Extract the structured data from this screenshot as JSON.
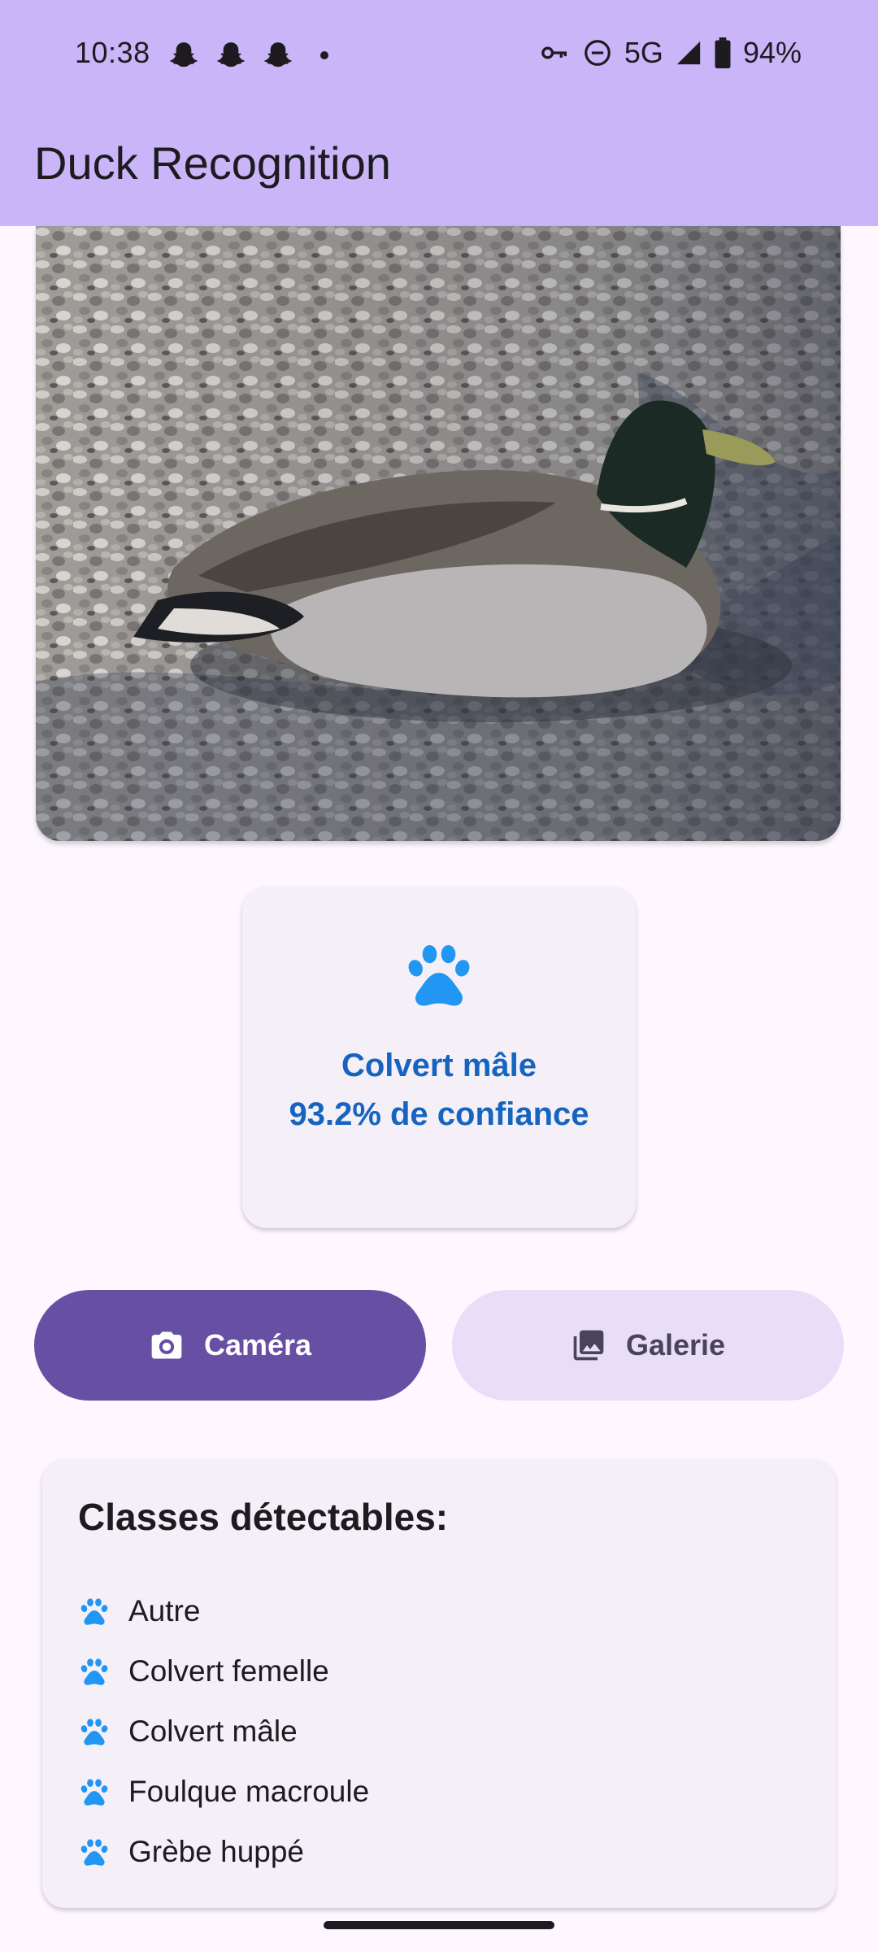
{
  "status_bar": {
    "time": "10:38",
    "notification_icons": [
      "snapchat-icon",
      "snapchat-icon",
      "snapchat-icon",
      "more-dot-icon"
    ],
    "right_icons": [
      "vpn-key-icon",
      "do-not-disturb-icon",
      "signal-icon",
      "battery-icon"
    ],
    "network": "5G",
    "battery": "94%"
  },
  "app_bar": {
    "title": "Duck Recognition"
  },
  "result": {
    "icon": "paw-icon",
    "label": "Colvert mâle",
    "confidence": "93.2% de confiance"
  },
  "buttons": {
    "camera": {
      "label": "Caméra",
      "icon": "camera-icon"
    },
    "gallery": {
      "label": "Galerie",
      "icon": "gallery-icon"
    }
  },
  "classes": {
    "title": "Classes détectables:",
    "items": [
      {
        "label": "Autre"
      },
      {
        "label": "Colvert femelle"
      },
      {
        "label": "Colvert mâle"
      },
      {
        "label": "Foulque macroule"
      },
      {
        "label": "Grèbe huppé"
      }
    ]
  },
  "colors": {
    "app_bar": "#c9b5f8",
    "background": "#fef7ff",
    "primary": "#6750a4",
    "secondary_container": "#e8def8",
    "result_text": "#1565c0",
    "paw": "#2196f3"
  }
}
